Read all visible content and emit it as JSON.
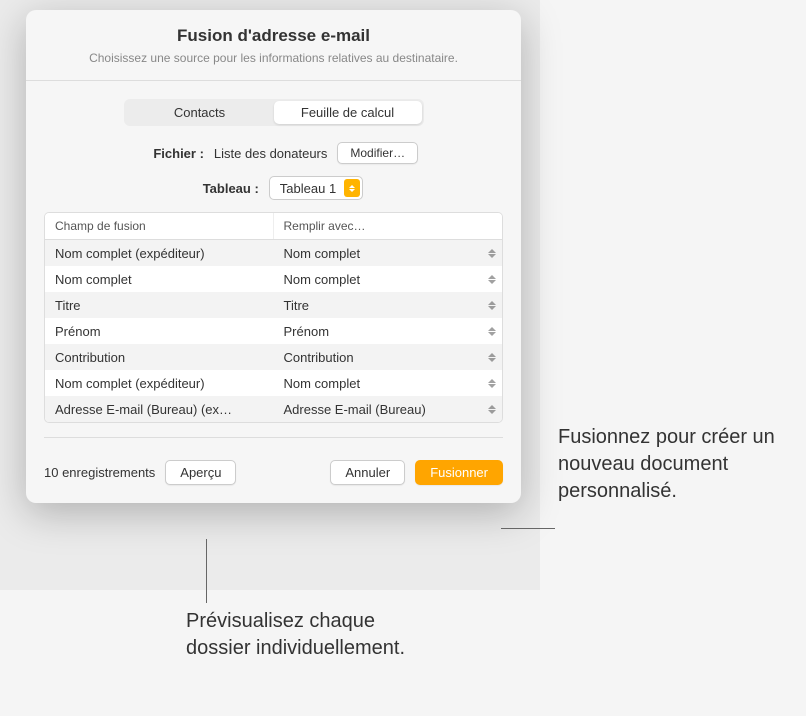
{
  "modal": {
    "title": "Fusion d'adresse e-mail",
    "subtitle": "Choisissez une source pour les informations relatives au destinataire."
  },
  "segmented": {
    "contacts": "Contacts",
    "spreadsheet": "Feuille de calcul"
  },
  "file": {
    "label": "Fichier :",
    "value": "Liste des donateurs",
    "change_btn": "Modifier…"
  },
  "table_select": {
    "label": "Tableau :",
    "value": "Tableau 1"
  },
  "cols": {
    "field": "Champ de fusion",
    "fill": "Remplir avec…"
  },
  "rows": [
    {
      "field": "Nom complet (expéditeur)",
      "fill": "Nom complet"
    },
    {
      "field": "Nom complet",
      "fill": "Nom complet"
    },
    {
      "field": "Titre",
      "fill": "Titre"
    },
    {
      "field": "Prénom",
      "fill": "Prénom"
    },
    {
      "field": "Contribution",
      "fill": "Contribution"
    },
    {
      "field": "Nom complet (expéditeur)",
      "fill": "Nom complet"
    },
    {
      "field": "Adresse E-mail (Bureau) (ex…",
      "fill": "Adresse E-mail (Bureau)"
    }
  ],
  "footer": {
    "records": "10 enregistrements",
    "preview": "Aperçu",
    "cancel": "Annuler",
    "merge": "Fusionner"
  },
  "callouts": {
    "merge_text": "Fusionnez pour créer un nouveau document personnalisé.",
    "preview_text": "Prévisualisez chaque dossier individuellement."
  }
}
